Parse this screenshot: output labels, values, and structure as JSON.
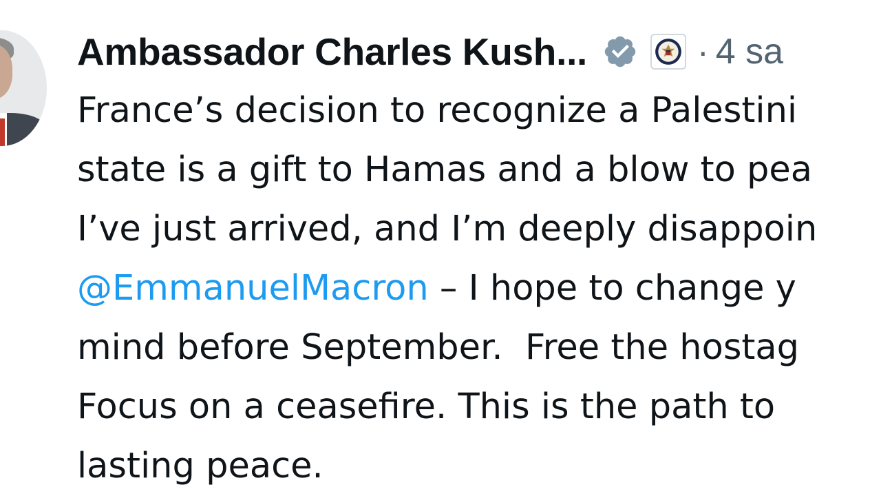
{
  "author": {
    "name": "Ambassador Charles Kush...",
    "verified_icon": "verified-badge-icon",
    "affiliate_icon": "state-department-seal-icon",
    "separator": "·",
    "timestamp": "4 sa"
  },
  "tweet": {
    "lines": [
      {
        "text": "France’s decision to recognize a Palestini"
      },
      {
        "text": "state is a gift to Hamas and a blow to pea"
      },
      {
        "text": "I’ve just arrived, and I’m deeply disappoin"
      },
      {
        "mention": "@EmmanuelMacron",
        "text": " – I hope to change y"
      },
      {
        "text": "mind before September.  Free the hostag"
      },
      {
        "text": "Focus on a ceasefire. This is the path to"
      },
      {
        "text": "lasting peace."
      }
    ]
  },
  "colors": {
    "text": "#0f1419",
    "secondary": "#536471",
    "link": "#1d9bf0",
    "verified_badge": "#829aab"
  }
}
